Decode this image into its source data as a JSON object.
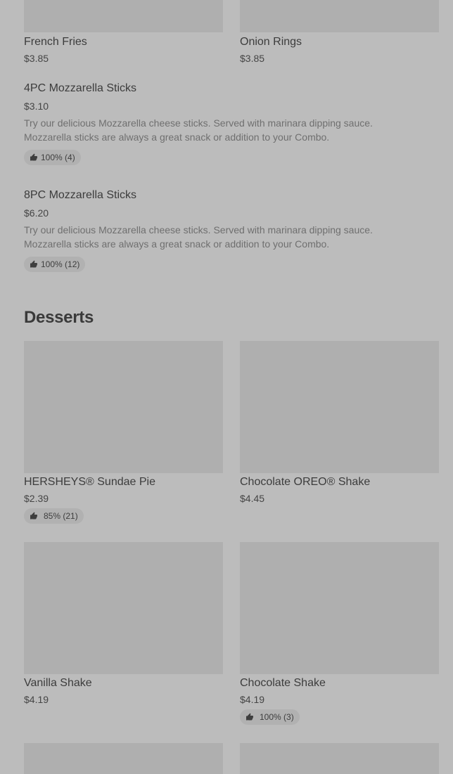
{
  "top_items": [
    {
      "name": "French Fries",
      "price": "$3.85"
    },
    {
      "name": "Onion Rings",
      "price": "$3.85"
    }
  ],
  "list_items": [
    {
      "name": "4PC Mozzarella Sticks",
      "price": "$3.10",
      "description_line1": "Try our delicious Mozzarella cheese sticks. Served with marinara dipping sauce.",
      "description_line2": "Mozzarella sticks are always a great snack or addition to your Combo.",
      "rating": "100% (4)"
    },
    {
      "name": "8PC Mozzarella Sticks",
      "price": "$6.20",
      "description_line1": "Try our delicious Mozzarella cheese sticks. Served with marinara dipping sauce.",
      "description_line2": "Mozzarella sticks are always a great snack or addition to your Combo.",
      "rating": "100% (12)"
    }
  ],
  "desserts": {
    "title": "Desserts",
    "items": [
      {
        "name": "HERSHEYS® Sundae Pie",
        "price": "$2.39",
        "rating": "85% (21)"
      },
      {
        "name": "Chocolate OREO® Shake",
        "price": "$4.45"
      },
      {
        "name": "Vanilla Shake",
        "price": "$4.19"
      },
      {
        "name": "Chocolate Shake",
        "price": "$4.19",
        "rating": "100% (3)"
      }
    ]
  },
  "icons": {
    "rating": "thumbs-up-icon"
  },
  "colors": {
    "background": "#bcbcbc",
    "image_placeholder": "#afafaf",
    "pill": "#b1b1b1"
  }
}
